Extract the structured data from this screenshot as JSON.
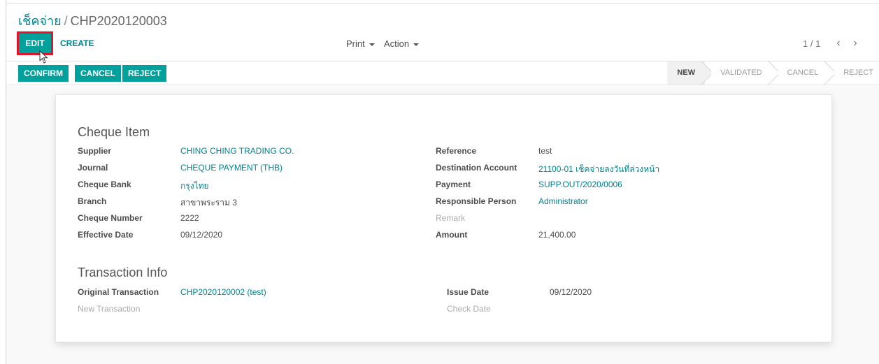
{
  "breadcrumb": {
    "parent": "เช็คจ่าย",
    "separator": "/",
    "current": "CHP2020120003"
  },
  "control_panel": {
    "edit_label": "EDIT",
    "create_label": "CREATE",
    "print_label": "Print",
    "action_label": "Action",
    "pager_value": "1 / 1",
    "prev_icon": "chevron-left-icon",
    "next_icon": "chevron-right-icon"
  },
  "header_buttons": {
    "confirm": "CONFIRM",
    "cancel": "CANCEL",
    "reject": "REJECT"
  },
  "statusbar": {
    "stages": [
      "NEW",
      "VALIDATED",
      "CANCEL",
      "REJECT"
    ],
    "active": "NEW"
  },
  "cheque_item": {
    "title": "Cheque Item",
    "left": [
      {
        "label": "Supplier",
        "value": "CHING CHING TRADING CO.",
        "link": true
      },
      {
        "label": "Journal",
        "value": "CHEQUE PAYMENT (THB)",
        "link": true
      },
      {
        "label": "Cheque Bank",
        "value": "กรุงไทย",
        "link": true
      },
      {
        "label": "Branch",
        "value": "สาขาพระราม 3",
        "link": false
      },
      {
        "label": "Cheque Number",
        "value": "2222",
        "link": false
      },
      {
        "label": "Effective Date",
        "value": "09/12/2020",
        "link": false
      }
    ],
    "right": [
      {
        "label": "Reference",
        "value": "test",
        "link": false
      },
      {
        "label": "Destination Account",
        "value": "21100-01 เช็คจ่ายลงวันที่ล่วงหน้า",
        "link": true
      },
      {
        "label": "Payment",
        "value": "SUPP.OUT/2020/0006",
        "link": true
      },
      {
        "label": "Responsible Person",
        "value": "Administrator",
        "link": true
      },
      {
        "label": "Remark",
        "value": "",
        "link": false
      },
      {
        "label": "Amount",
        "value": "21,400.00",
        "link": false
      }
    ]
  },
  "transaction_info": {
    "title": "Transaction Info",
    "original_label": "Original Transaction",
    "original_value": "CHP2020120002 (test)",
    "new_label": "New Transaction",
    "issue_label": "Issue Date",
    "issue_value": "09/12/2020",
    "check_label": "Check Date"
  },
  "colors": {
    "primary": "#00a09d",
    "link": "#00838f",
    "highlight": "#e3152a"
  }
}
